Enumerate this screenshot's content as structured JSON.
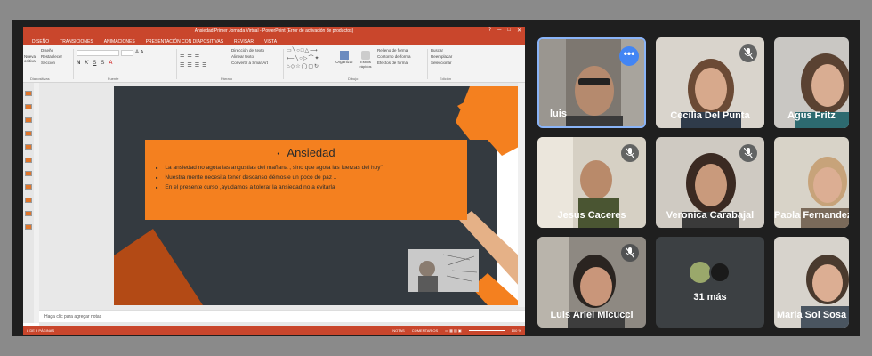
{
  "ppt": {
    "window_title": "Ansiedad Primer Jornada Virtual  -  PowerPoint (Error de activación de productos)",
    "window_controls": [
      "?",
      "─",
      "□",
      "✕"
    ],
    "tabs": [
      "DISEÑO",
      "TRANSICIONES",
      "ANIMACIONES",
      "PRESENTACIÓN CON DIAPOSITIVAS",
      "REVISAR",
      "VISTA"
    ],
    "ribbon_groups": {
      "diapositivas": {
        "items": [
          "Diseño",
          "Restablecer",
          "Sección"
        ],
        "prefix": [
          "Nueva",
          "ositiva"
        ],
        "label": "Diapositivas"
      },
      "fuente": {
        "label": "Fuente"
      },
      "parrafo": {
        "items": [
          "Dirección del texto",
          "Alinear texto",
          "Convertir a SmartArt"
        ],
        "label": "Párrafo"
      },
      "dibujo": {
        "organizar": "Organizar",
        "estilos": "Estilos rápidos",
        "items": [
          "Relleno de forma",
          "Contorno de forma",
          "Efectos de forma"
        ],
        "label": "Dibujo"
      },
      "edicion": {
        "items": [
          "Buscar",
          "Reemplazar",
          "Seleccionar"
        ],
        "label": "Edición"
      }
    },
    "slide": {
      "title": "Ansiedad",
      "bullets": [
        "La ansiedad no agota  las angustias del mañana , sino que agota las fuerzas del hoy\"",
        "Nuestra mente necesita tener descanso démosle un poco de paz ..",
        "En el presente curso ,ayudamos a tolerar la ansiedad no a evitarla"
      ]
    },
    "notes_placeholder": "Haga clic para agregar notas",
    "status": {
      "left": "8 DE 9 PÁGINAS",
      "notes": "NOTAS",
      "comments": "COMENTARIOS",
      "zoom": "100 %"
    }
  },
  "meet": {
    "participants": [
      {
        "name": "luis",
        "muted": false,
        "speaking": true
      },
      {
        "name": "Cecilia Del Punta",
        "muted": true
      },
      {
        "name": "Agus Fritz",
        "muted": false
      },
      {
        "name": "Jesus Caceres",
        "muted": true
      },
      {
        "name": "Veronica Carabajal",
        "muted": true
      },
      {
        "name": "Paola Fernandez",
        "muted": false
      },
      {
        "name": "Luis Ariel Micucci",
        "muted": true
      },
      {
        "name": "31 más",
        "muted": false
      },
      {
        "name": "Maria Sol Sosa",
        "muted": false
      }
    ],
    "more_options_glyph": "•••",
    "colors": {
      "accent": "#4285f4",
      "tile_bg": "#3c4043",
      "active_border": "#8ab4f8",
      "ppt_red": "#c9462c",
      "slide_orange": "#f4801f"
    }
  }
}
